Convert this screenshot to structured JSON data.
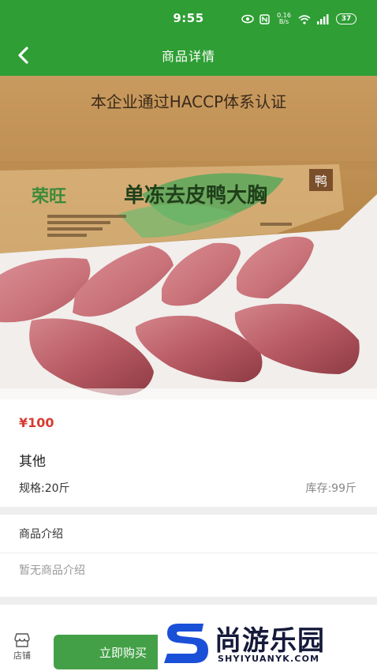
{
  "status_bar": {
    "time": "9:55",
    "net_speed": "0.16 B/s",
    "battery": "37",
    "icons": [
      "eye-icon",
      "nfc-icon",
      "speed-icon",
      "wifi-icon",
      "signal-icon",
      "battery-icon"
    ]
  },
  "navbar": {
    "title": "商品详情",
    "back_icon": "chevron-left-icon"
  },
  "product_image": {
    "box_banner": "本企业通过HACCP体系认证",
    "brand": "荣旺",
    "product_name": "单冻去皮鸭大胸",
    "box_tag": "鸭"
  },
  "product": {
    "price": "¥100",
    "name": "其他",
    "spec": "规格:20斤",
    "stock": "库存:99斤"
  },
  "intro": {
    "title": "商品介绍",
    "text": "暂无商品介绍"
  },
  "bottom_bar": {
    "store_label": "店铺",
    "buy_label": "立即购买"
  },
  "watermark": {
    "logo_letter": "S",
    "text": "尚游乐园",
    "url": "SHYIYUANYK.COM"
  },
  "colors": {
    "header": "#2f9e35",
    "buy_button": "#43a047",
    "price": "#d83a2f",
    "watermark_blue": "#1a4fd8"
  }
}
